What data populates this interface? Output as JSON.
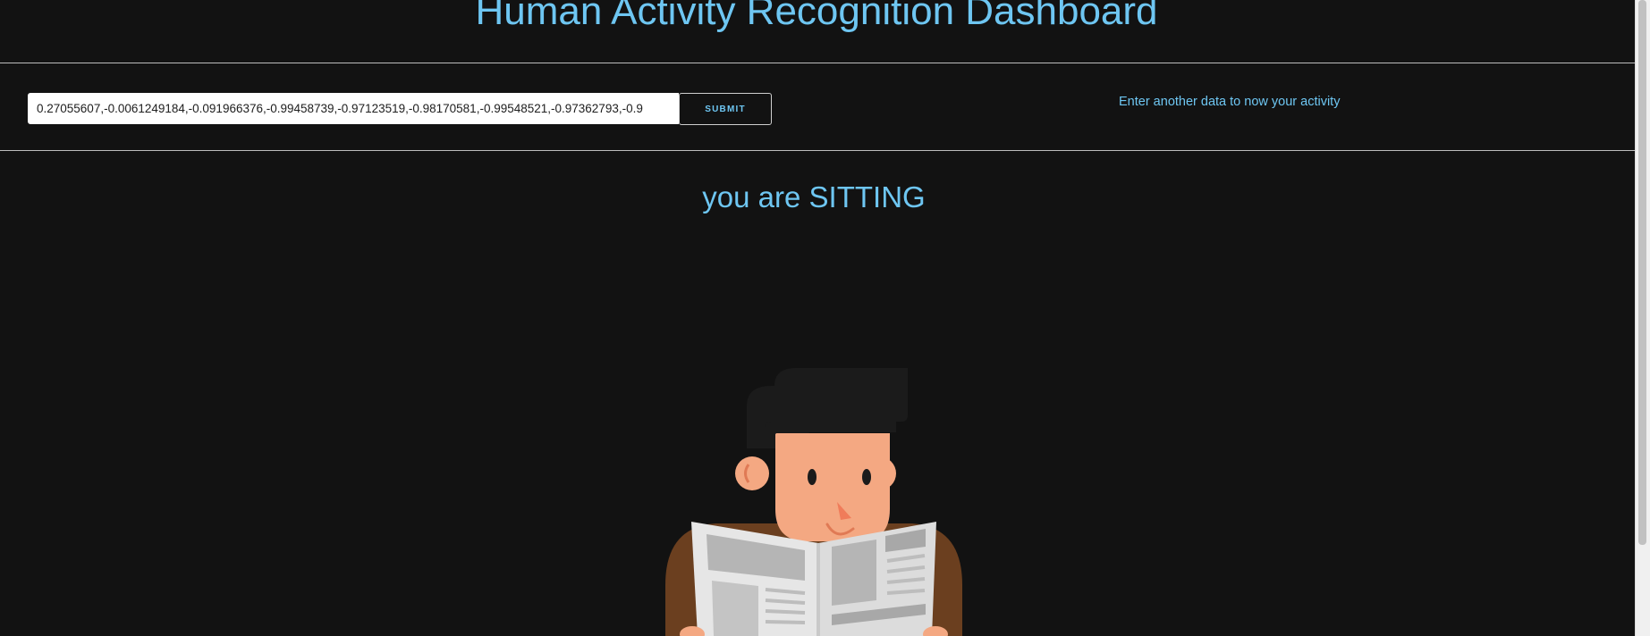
{
  "page": {
    "title": "Human Activity Recognition Dashboard"
  },
  "form": {
    "input_value": "0.27055607,-0.0061249184,-0.091966376,-0.99458739,-0.97123519,-0.98170581,-0.99548521,-0.97362793,-0.9",
    "submit_label": "SUBMIT",
    "hint": "Enter another data to now your activity"
  },
  "result": {
    "text": "you are SITTING"
  },
  "illustration": {
    "icon": "person-reading-newspaper-icon",
    "colors": {
      "hair": "#1b1b1b",
      "skin": "#f4a882",
      "nose": "#f07c5a",
      "jacket": "#6b3f1f",
      "paper": "#e6e6e6",
      "paper_dark": "#b5b5b5"
    }
  },
  "colors": {
    "background": "#121212",
    "accent": "#6ec6f2",
    "rule": "#bdbdbd"
  }
}
